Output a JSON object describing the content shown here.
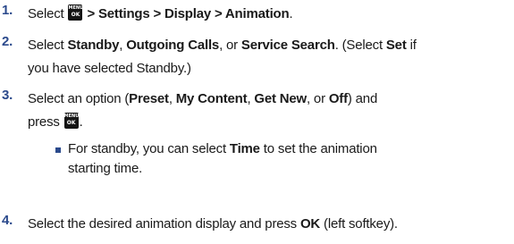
{
  "steps": [
    {
      "number": "1.",
      "p1": "Select ",
      "b1": "> Settings > Display > Animation",
      "p2": "."
    },
    {
      "number": "2.",
      "p1": "Select ",
      "b1": "Standby",
      "p2": ", ",
      "b2": "Outgoing Calls",
      "p3": ", or ",
      "b3": "Service Search",
      "p4": ". (Select ",
      "b4": "Set",
      "p5": " if",
      "line2": "you have selected Standby.)"
    },
    {
      "number": "3.",
      "p1": "Select an option (",
      "b1": "Preset",
      "p2": ", ",
      "b2": "My Content",
      "p3": ", ",
      "b3": "Get New",
      "p4": ", or ",
      "b4": "Off",
      "p5": ") and",
      "line2": "press",
      "line2_end": ".",
      "sub": {
        "p1": "For standby, you can select ",
        "b1": "Time",
        "p2": " to set the animation",
        "line2": "starting time."
      }
    },
    {
      "number": "4.",
      "p1": "Select the desired animation display and press ",
      "b1": "OK",
      "p2": " (left softkey)."
    }
  ],
  "menu_key": {
    "top": "MENU",
    "bottom": "OK"
  },
  "icons": {
    "key": "menu-ok-key-icon",
    "bullet": "square-bullet-icon"
  },
  "colors": {
    "number": "#2b4a8c",
    "bullet": "#2b4a8c",
    "key_bg": "#151515",
    "text": "#1a1a1a"
  }
}
